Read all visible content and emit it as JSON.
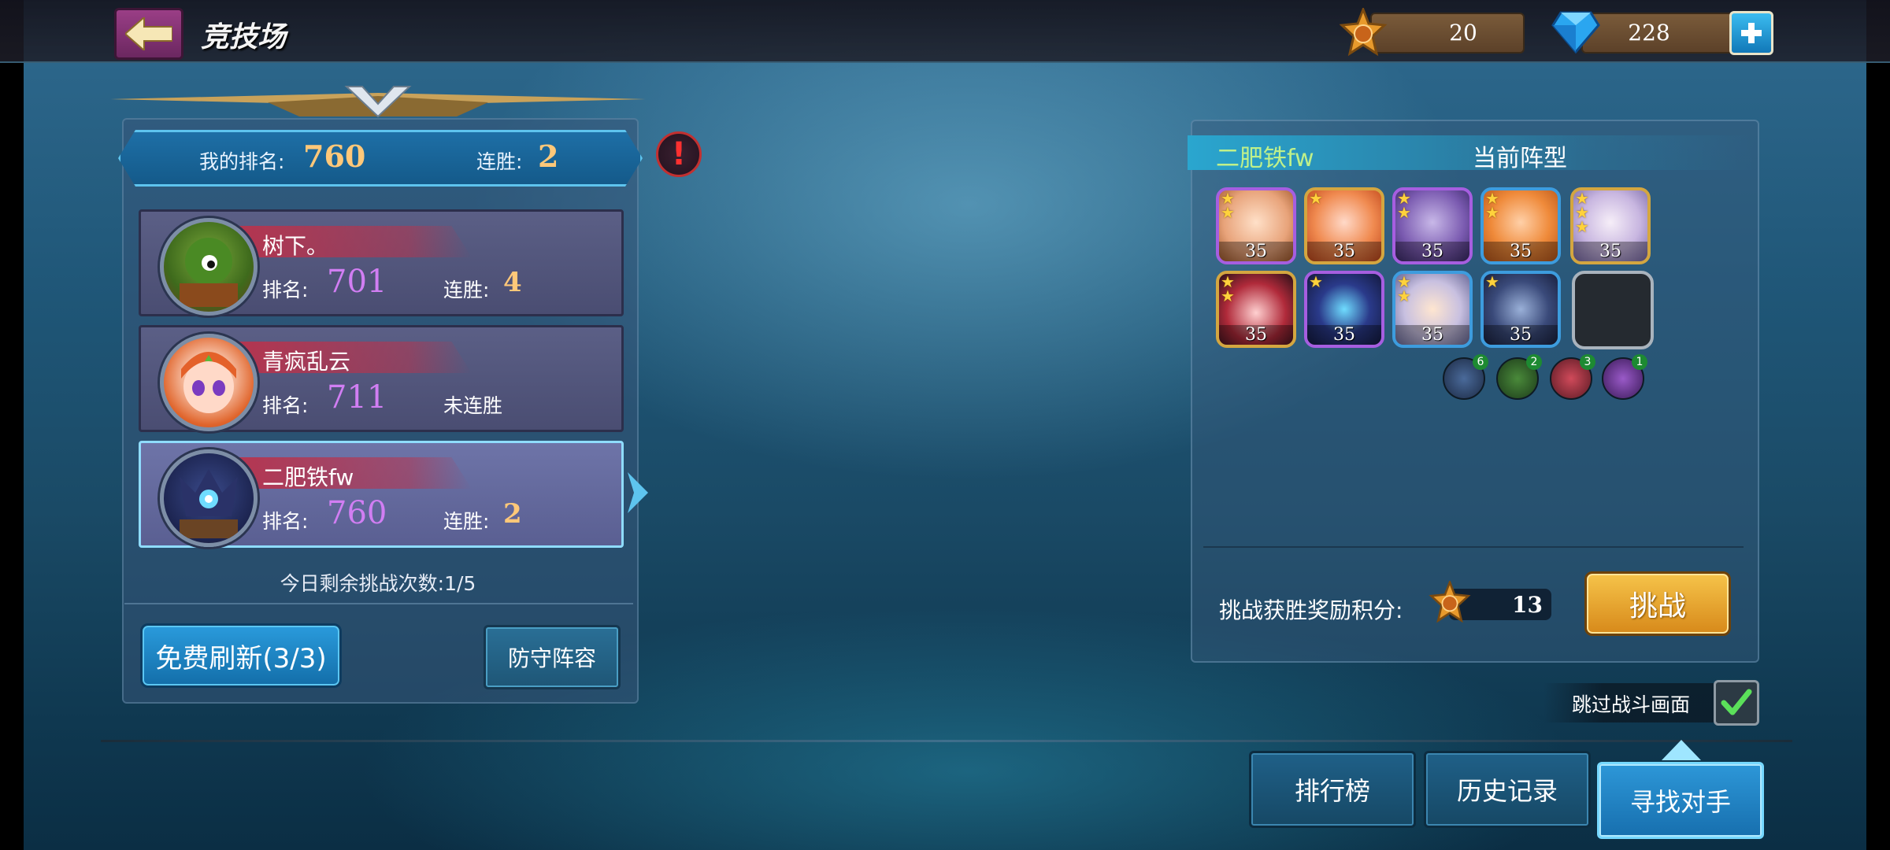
{
  "header": {
    "title": "竞技场",
    "medals": "20",
    "gems": "228"
  },
  "my_info": {
    "rank_label": "我的排名:",
    "rank_value": "760",
    "streak_label": "连胜:",
    "streak_value": "2"
  },
  "opponents": [
    {
      "name": "树下。",
      "rank_label": "排名:",
      "rank": "701",
      "streak_label": "连胜:",
      "streak": "4"
    },
    {
      "name": "青疯乱云",
      "rank_label": "排名:",
      "rank": "711",
      "streak_label": "未连胜",
      "streak": ""
    },
    {
      "name": "二肥铁fw",
      "rank_label": "排名:",
      "rank": "760",
      "streak_label": "连胜:",
      "streak": "2"
    }
  ],
  "remaining": "今日剩余挑战次数:1/5",
  "buttons": {
    "refresh": "免费刷新(3/3)",
    "defense": "防守阵容",
    "challenge": "挑战",
    "leaderboard": "排行榜",
    "history": "历史记录",
    "find": "寻找对手"
  },
  "formation": {
    "player_name": "二肥铁fw",
    "label": "当前阵型",
    "hero_levels": [
      "35",
      "35",
      "35",
      "35",
      "35",
      "35",
      "35",
      "35",
      "35"
    ],
    "faction_counts": [
      "6",
      "2",
      "3",
      "1"
    ]
  },
  "reward": {
    "label": "挑战获胜奖励积分:",
    "value": "13"
  },
  "skip_label": "跳过战斗画面",
  "colors": {
    "accent_blue": "#2a9bdc",
    "rank_purple": "#d17ef3",
    "streak_gold": "#ffc879",
    "challenge_gold": "#f6c44a"
  }
}
